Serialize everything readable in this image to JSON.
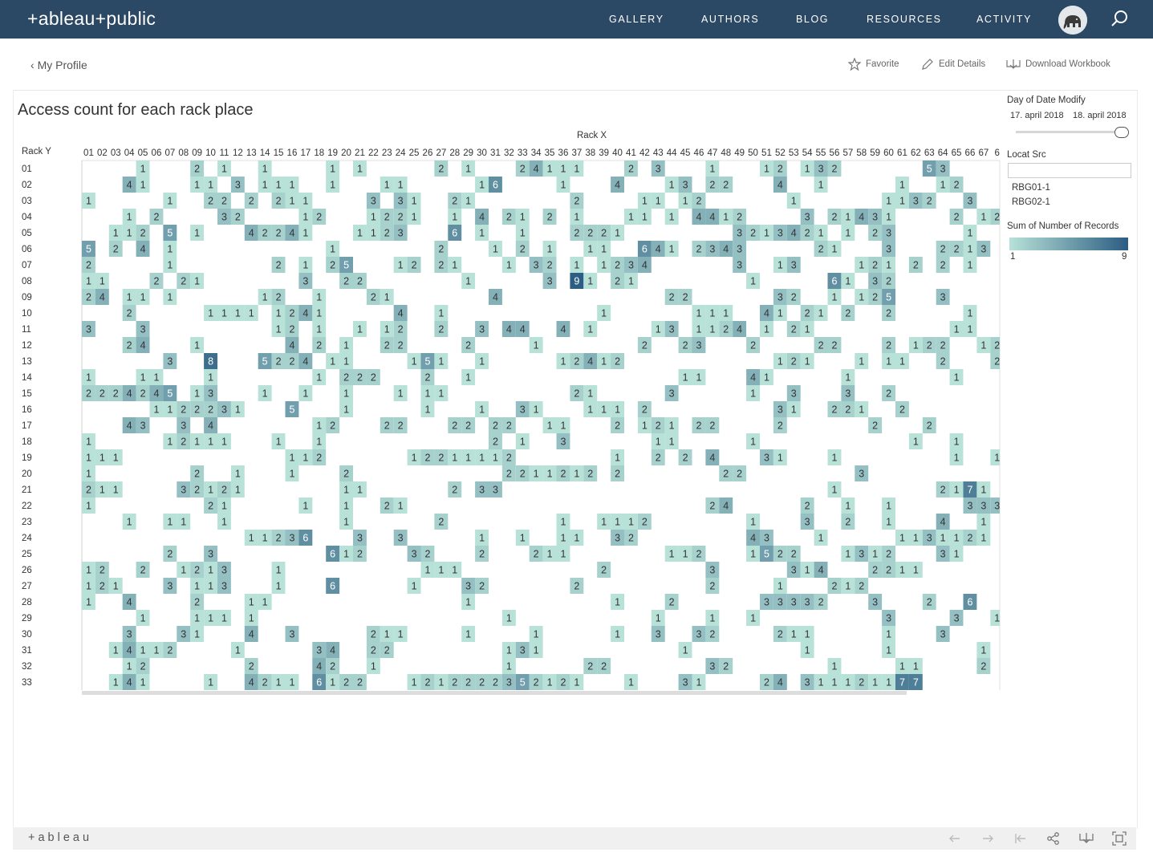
{
  "nav": {
    "logo": "+ableau+public",
    "links": [
      "GALLERY",
      "AUTHORS",
      "BLOG",
      "RESOURCES",
      "ACTIVITY"
    ]
  },
  "subnav": {
    "back_label": "My Profile",
    "favorite_label": "Favorite",
    "edit_label": "Edit Details",
    "download_label": "Download Workbook"
  },
  "viz": {
    "title": "Access count for each rack place",
    "x_axis_title": "Rack X",
    "y_axis_title": "Rack Y",
    "x_labels": [
      "01",
      "02",
      "03",
      "04",
      "05",
      "06",
      "07",
      "08",
      "09",
      "10",
      "11",
      "12",
      "13",
      "14",
      "15",
      "16",
      "17",
      "18",
      "19",
      "20",
      "21",
      "22",
      "23",
      "24",
      "25",
      "26",
      "27",
      "28",
      "29",
      "30",
      "31",
      "32",
      "33",
      "34",
      "35",
      "36",
      "37",
      "38",
      "39",
      "40",
      "41",
      "42",
      "43",
      "44",
      "45",
      "46",
      "47",
      "48",
      "49",
      "50",
      "51",
      "52",
      "53",
      "54",
      "55",
      "56",
      "57",
      "58",
      "59",
      "60",
      "61",
      "62",
      "63",
      "64",
      "65",
      "66",
      "67",
      "6"
    ],
    "y_labels": [
      "01",
      "02",
      "03",
      "04",
      "05",
      "06",
      "07",
      "08",
      "09",
      "10",
      "11",
      "12",
      "13",
      "14",
      "15",
      "16",
      "17",
      "18",
      "19",
      "20",
      "21",
      "22",
      "23",
      "24",
      "25",
      "26",
      "27",
      "28",
      "29",
      "30",
      "31",
      "32",
      "33"
    ],
    "rows": [
      "....1...2.1..1....1.1.....2.1...24111...2.3...1...12.132......53......1..",
      "...41...11.3.111..1...11.....16....1...4...13.22...4..1.....1..12...111..",
      "1.....1..22.2.211....3.31..21.......2....11.12......1......1132..3...2...",
      "...1.2....32....12...1221..1.4.21.2.1...11.1.4412....3.21431....2.1226.5.",
      "..112.5.1...42241...1123...6.1..1...2221........3213421.1.23.....1...11..",
      "5.2.4.1...........1.......2...1.2.1..11..641.2343.....21...3...2213..3...",
      "2.....1.......2.1.25...12.21...1.32.1.1234......3..13....121.2.2.1...2.3.",
      "11...2.21.......3..22.......1.....3.91.21........1.....61.32..........1.1",
      "24.11.1......12..1...21.......4............22......32..1.125...3....4.2.4",
      "...2.....1111.1241.....4..1...........1......111..41.21.2..2.....1...1...",
      "3...3.........12.1..1.12..2..3.44..4.1....13.1124.1.21..........11....111",
      "...24...1......4.2.1..22....2....1.......2..23...2....22...2.122..1214.41.",
      "......3..8...5224.11....151..1.....12412...........121...1.11..2...2..13.",
      "1...11...1.......1.222...2..1...............11...41.....1.......1.....1.1",
      "2224245.13...1..1..1...1.11.........21.....3.....1..3...3..2............2",
      ".....1122231...5...1.....1...1..31...111.2.........31..221..2.......24..2",
      "...43..3.4.......12...22...22.22..11...2.121.22....2......2...2.......314",
      "1.....12111...1..1............2.1..3......11.....1...........1..1...1....",
      "111............112......12211112.......1..2.2.4...31...1........1..122...",
      "1.......2..1...1...2...........2211212.2.......22........3..........2....",
      "211....32121.......11......2.33........................1.......2171......",
      "1........21.....1..1..21......................24.....2..1..1.....33333124",
      "...1..11..1........1......2........1..1112.......1...3..2..1...4..1....3.",
      "............11236...3..3.....1..1..11..32........43...1.....1131121......",
      "......2..3........612...32...2...211.......112...1522...1312...31....2...",
      "12..2..1213...1..........111..........2.......3.....314...2211.......1...",
      "121...3.113...1...6.....1...32......2.........2....1...212..........1212.",
      "1..4....2...11..............1..........1...2......33332...3...2..6.......",
      "....1...111.1..................1..........1...1..1.........3....3..11....",
      "...3...31...4..3.....211....1....1.....1..3..32....211.....1...3.....1...",
      "..14112....1.....34..22........131..........1........1.....1......1.1321.",
      "...12.......2....42..1.........1.....22.......32.......1....11....2..1...",
      "..141....1..4211.6122...1212222352121...1...31....24.311121177..."
    ],
    "color_min": "#b8e1d8",
    "color_max": "#2c5d82"
  },
  "side": {
    "date_filter_title": "Day of Date Modify",
    "date_start": "17. april 2018",
    "date_end": "18. april 2018",
    "locat_title": "Locat Src",
    "locat_search_placeholder": "",
    "locat_values": [
      "RBG01-1",
      "RBG02-1"
    ],
    "legend_title": "Sum of Number of Records",
    "legend_min": "1",
    "legend_max": "9"
  },
  "footer": {
    "brand": "+ableau"
  }
}
